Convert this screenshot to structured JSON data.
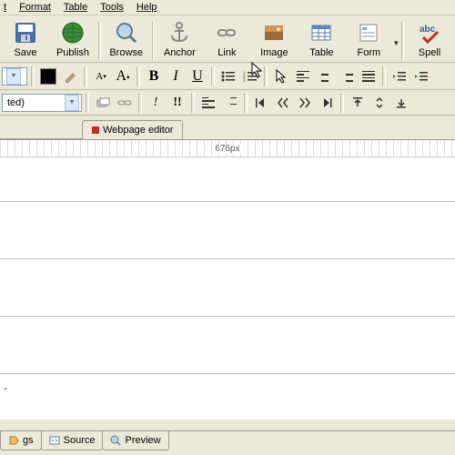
{
  "menu": {
    "items": [
      "t",
      "Format",
      "Table",
      "Tools",
      "Help"
    ]
  },
  "toolbar": {
    "save": "Save",
    "publish": "Publish",
    "browse": "Browse",
    "anchor": "Anchor",
    "link": "Link",
    "image": "Image",
    "table": "Table",
    "form": "Form",
    "spell": "Spell"
  },
  "fmt": {
    "bold": "B",
    "italic": "I",
    "underline": "U",
    "smallA": "A",
    "bigA": "A"
  },
  "style_combo": "ted)",
  "tabs": {
    "editor": "Webpage editor"
  },
  "ruler": "676px",
  "bottom": {
    "tags": "gs",
    "source": "Source",
    "preview": "Preview"
  }
}
